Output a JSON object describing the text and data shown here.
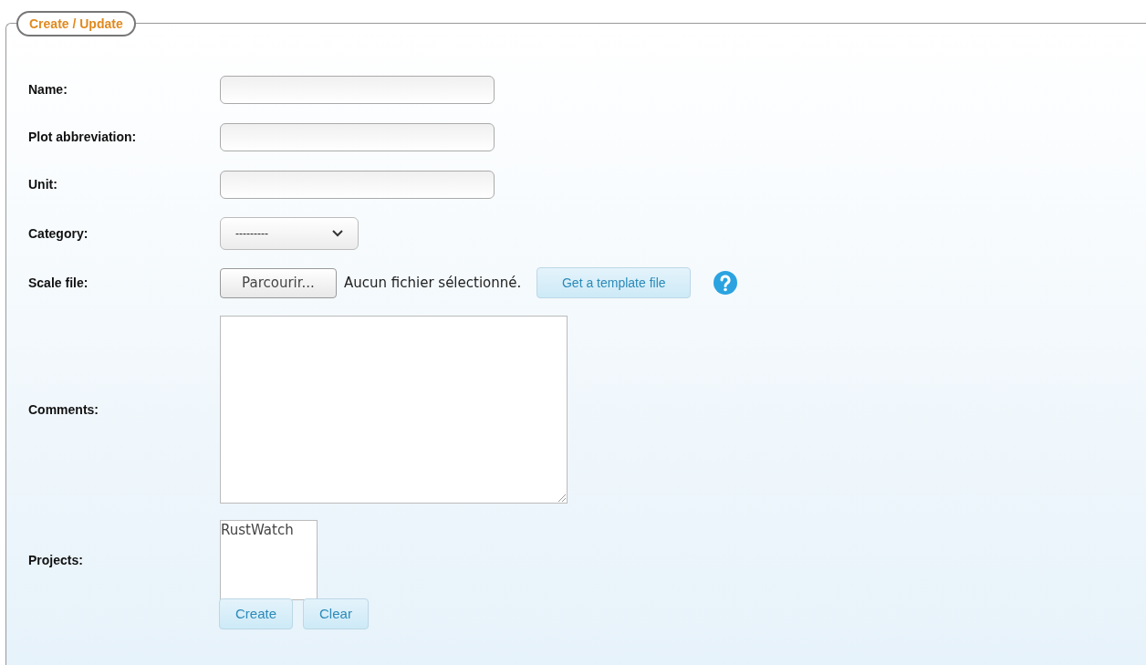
{
  "legend": "Create / Update",
  "fields": [
    {
      "kind": "text",
      "label": "Name:"
    },
    {
      "kind": "text",
      "label": "Plot abbreviation:"
    },
    {
      "kind": "text",
      "label": "Unit:"
    },
    {
      "kind": "select",
      "label": "Category:",
      "value": "---------"
    },
    {
      "kind": "file",
      "label": "Scale file:",
      "browse": "Parcourir...",
      "status": "Aucun fichier sélectionné.",
      "template_button": "Get a template file"
    },
    {
      "kind": "textarea",
      "label": "Comments:"
    },
    {
      "kind": "listbox",
      "label": "Projects:",
      "options": [
        {
          "label": "RustWatch",
          "selected": false
        }
      ]
    }
  ],
  "buttons": [
    "Create",
    "Clear"
  ]
}
